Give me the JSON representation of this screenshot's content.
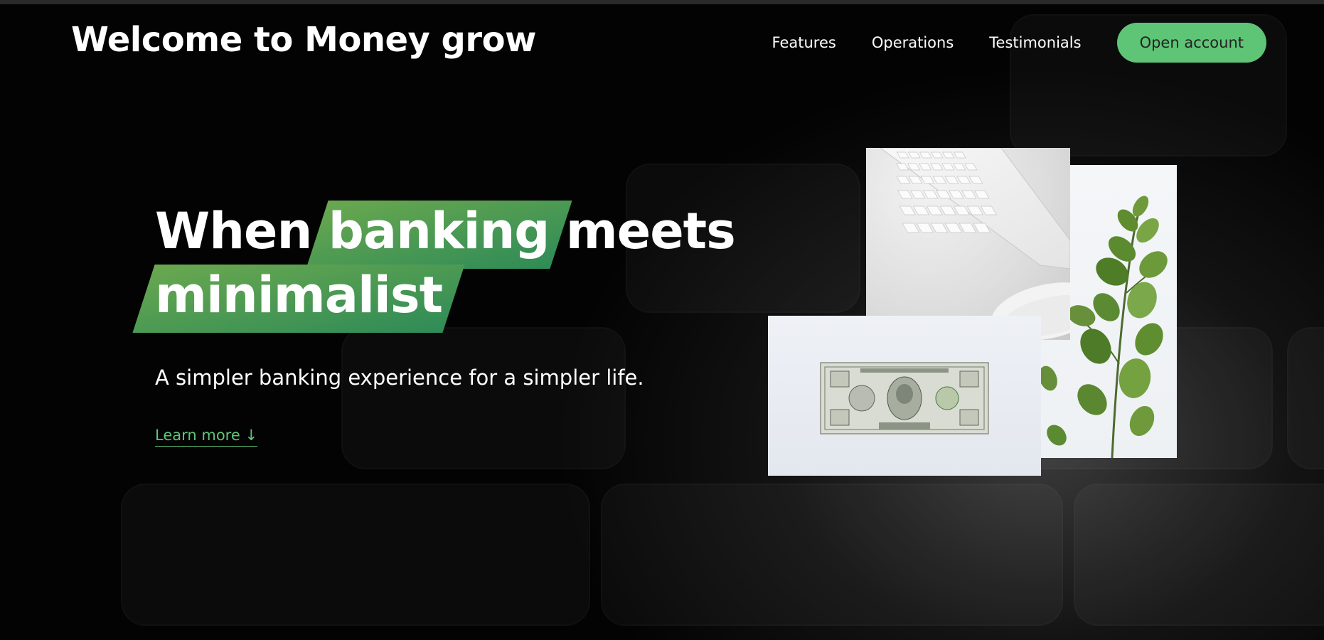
{
  "header": {
    "logo_text": "Welcome to Money grow",
    "nav": [
      {
        "label": "Features"
      },
      {
        "label": "Operations"
      },
      {
        "label": "Testimonials"
      }
    ],
    "cta_label": "Open account"
  },
  "hero": {
    "title_word_1": "When",
    "title_highlight_1": "banking",
    "title_word_2": "meets",
    "title_highlight_2": "minimalist",
    "subtitle": "A simpler banking experience for a simpler life.",
    "learn_more": "Learn more ↓"
  },
  "images": [
    {
      "subject": "keyboard and mouse"
    },
    {
      "subject": "eucalyptus plant"
    },
    {
      "subject": "one dollar bill"
    }
  ],
  "colors": {
    "accent": "#5ec576",
    "highlight_start": "#6aa84f",
    "highlight_end": "#2e8b57",
    "background": "#000000"
  }
}
